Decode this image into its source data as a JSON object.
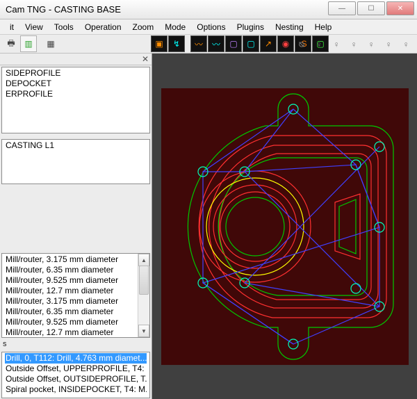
{
  "window": {
    "title": "Cam TNG - CASTING BASE"
  },
  "menu": {
    "items": [
      "it",
      "View",
      "Tools",
      "Operation",
      "Zoom",
      "Mode",
      "Options",
      "Plugins",
      "Nesting",
      "Help"
    ]
  },
  "panels": {
    "close_icon": "✕",
    "layers": [
      "SIDEPROFILE",
      "DEPOCKET",
      "ERPROFILE"
    ],
    "parts": [
      "CASTING L1"
    ],
    "tools": [
      "Mill/router, 3.175 mm diameter",
      "Mill/router, 6.35 mm diameter",
      "Mill/router, 9.525 mm diameter",
      "Mill/router, 12.7 mm diameter",
      "Mill/router, 3.175 mm diameter",
      "Mill/router, 6.35 mm diameter",
      "Mill/router, 9.525 mm diameter",
      "Mill/router, 12.7 mm diameter"
    ],
    "ops_header": "s",
    "ops": [
      "Drill, 0, T112: Drill, 4.763 mm diamet...",
      "Outside Offset, UPPERPROFILE, T4:",
      "Outside Offset, OUTSIDEPROFILE, T...",
      "Spiral pocket, INSIDEPOCKET, T4: M..."
    ],
    "ops_selected_index": 0
  },
  "win_controls": {
    "min": "—",
    "max": "☐",
    "close": "✕"
  },
  "colors": {
    "canvas_bg": "#400808",
    "outer_profile": "#00c800",
    "red_profile": "#ff3030",
    "yellow": "#ffff00",
    "toolpath_blue": "#4040ff",
    "hole_green": "#00ffbb",
    "hole_dot": "#006666"
  }
}
